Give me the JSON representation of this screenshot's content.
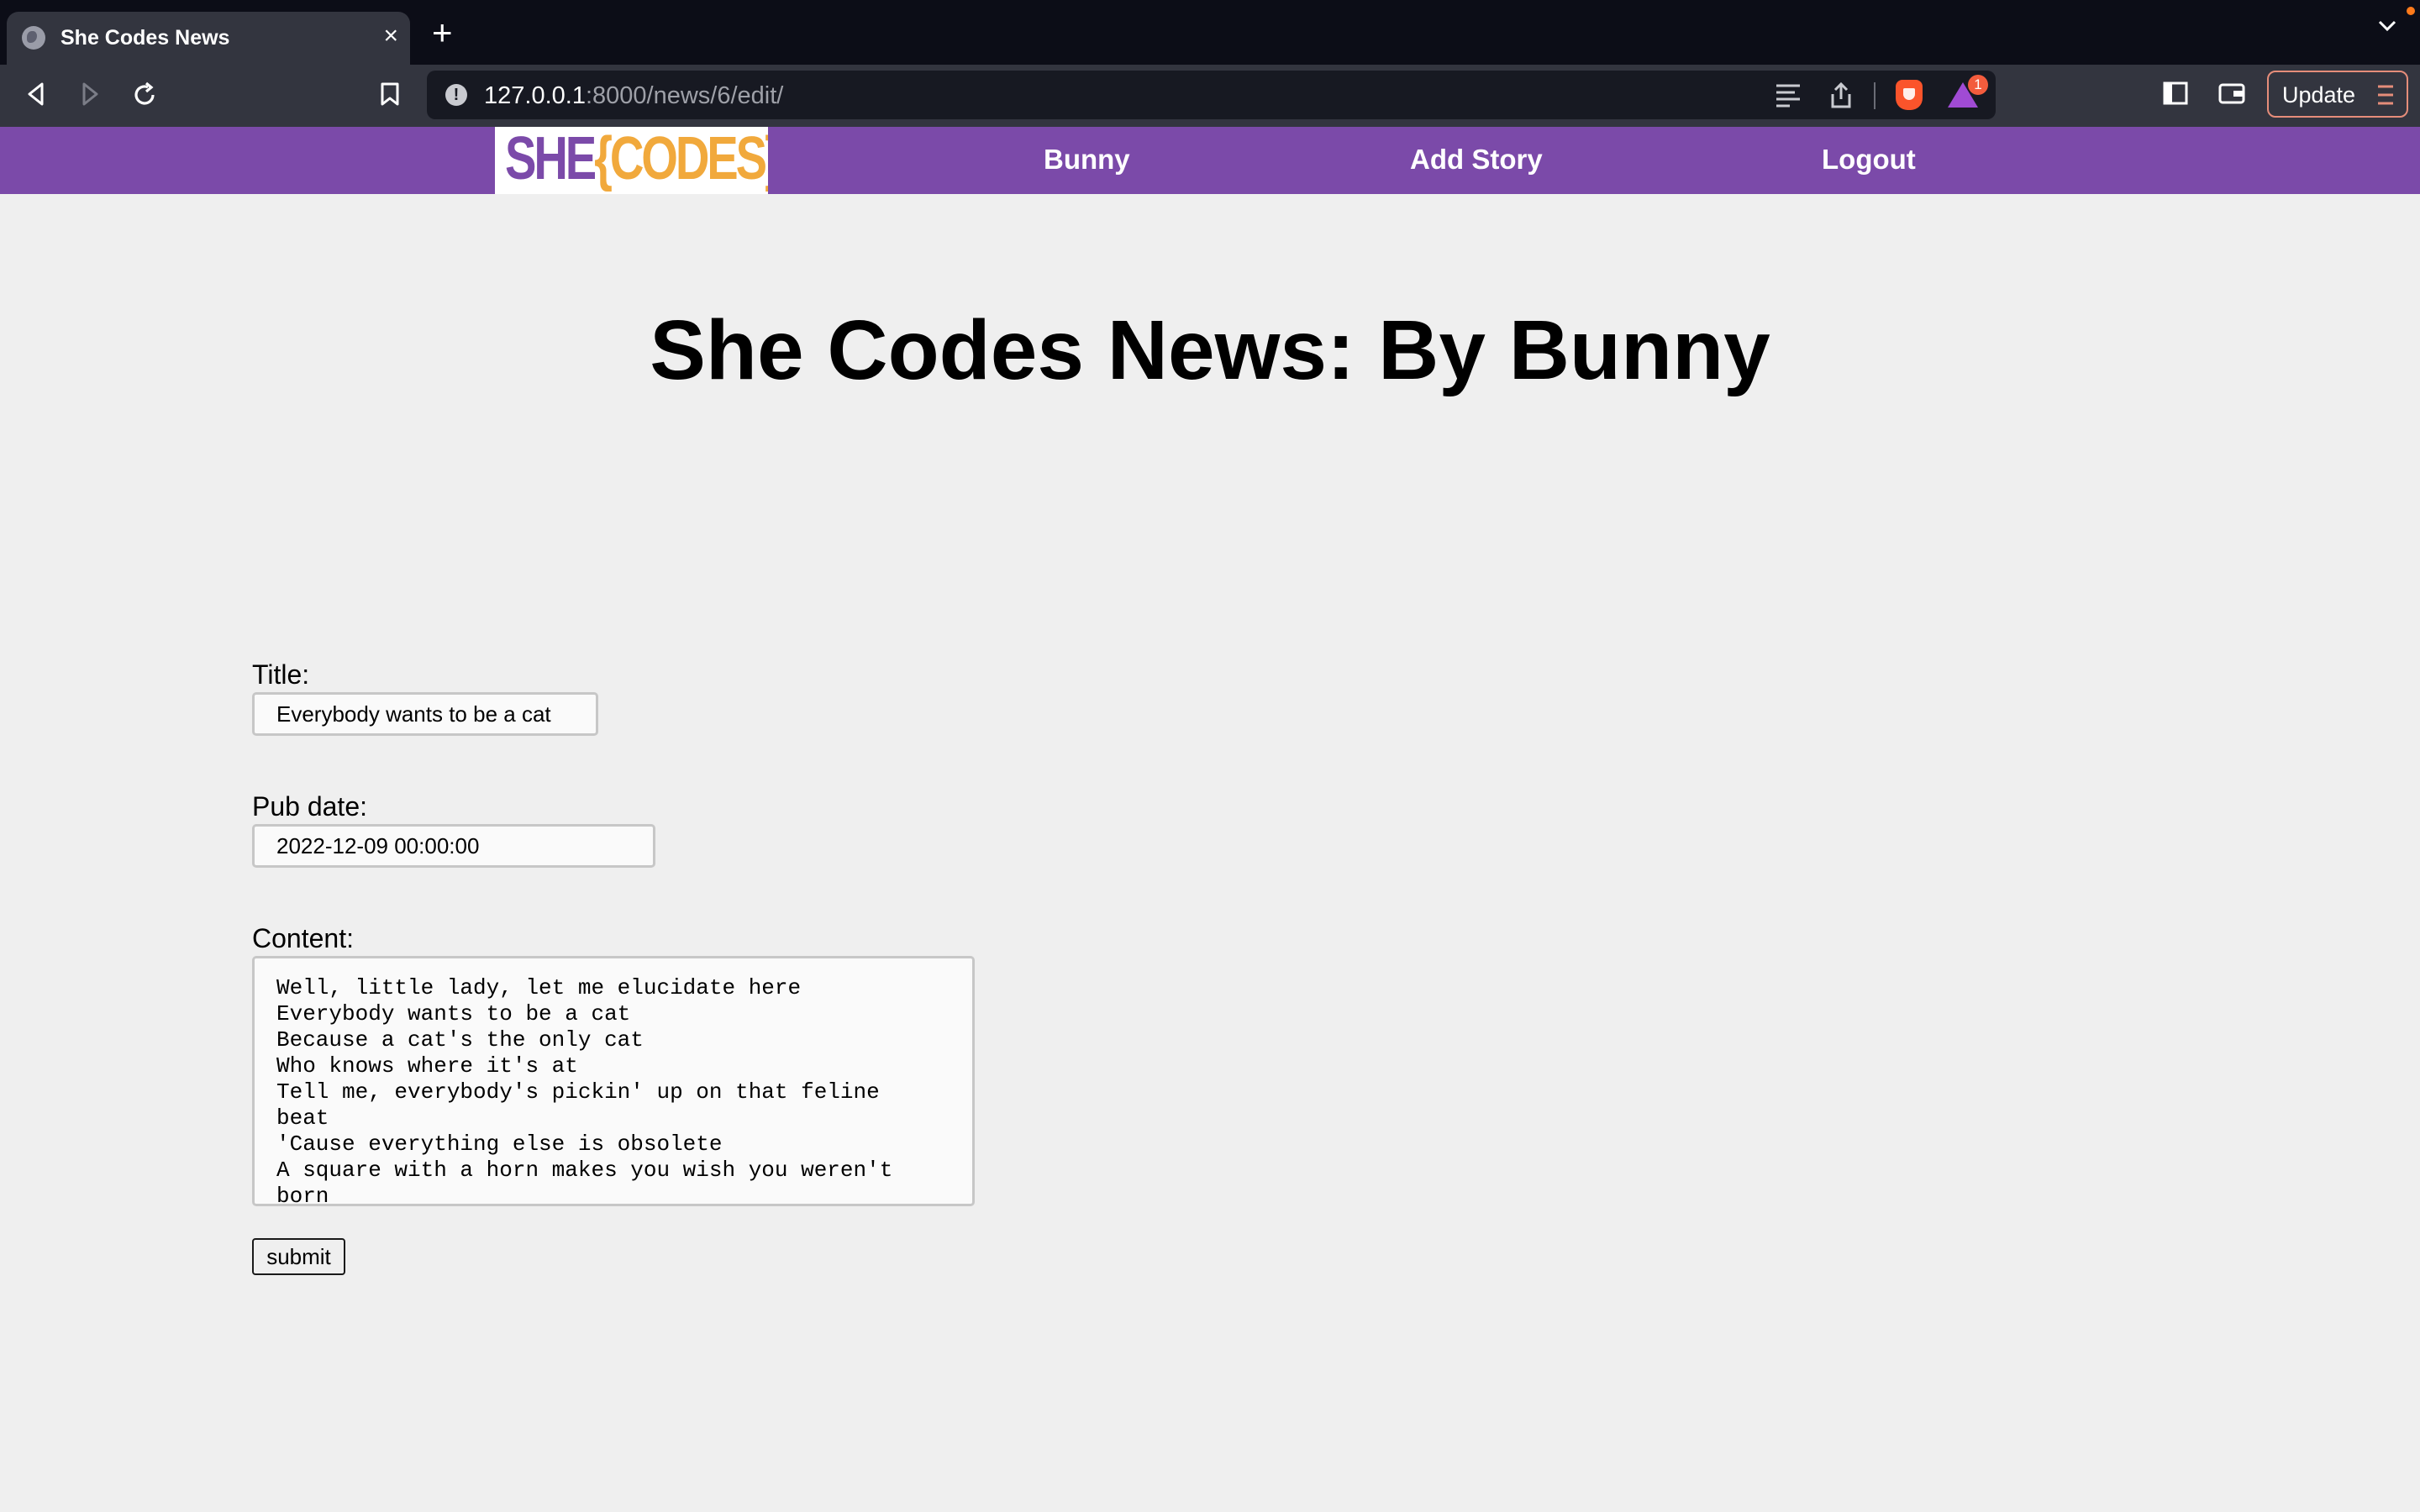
{
  "browser": {
    "tab_title": "She Codes News",
    "tab_close": "×",
    "new_tab": "+",
    "url_host": "127.0.0.1",
    "url_path": ":8000/news/6/edit/",
    "rewards_badge": "1",
    "update_label": "Update"
  },
  "nav": {
    "logo_she": "SHE",
    "logo_codes": "{CODES}",
    "links": [
      "Bunny",
      "Add Story",
      "Logout"
    ]
  },
  "page": {
    "title": "She Codes News: By Bunny"
  },
  "form": {
    "title_label": "Title:",
    "title_value": "Everybody wants to be a cat",
    "pub_date_label": "Pub date:",
    "pub_date_value": "2022-12-09 00:00:00",
    "content_label": "Content:",
    "content_lines": [
      "Well, little lady, let me elucidate here",
      "Everybody wants to be a cat",
      "Because a cat's the only cat",
      "Who knows where it's at",
      "Tell me, everybody's pickin' up on that feline",
      "beat",
      "'Cause everything else is obsolete",
      "A square with a horn makes you wish you weren't",
      "born"
    ],
    "submit_label": "submit"
  },
  "colors": {
    "nav_purple": "#7b4aa9",
    "logo_orange": "#f1a93c",
    "page_bg": "#efefef"
  }
}
